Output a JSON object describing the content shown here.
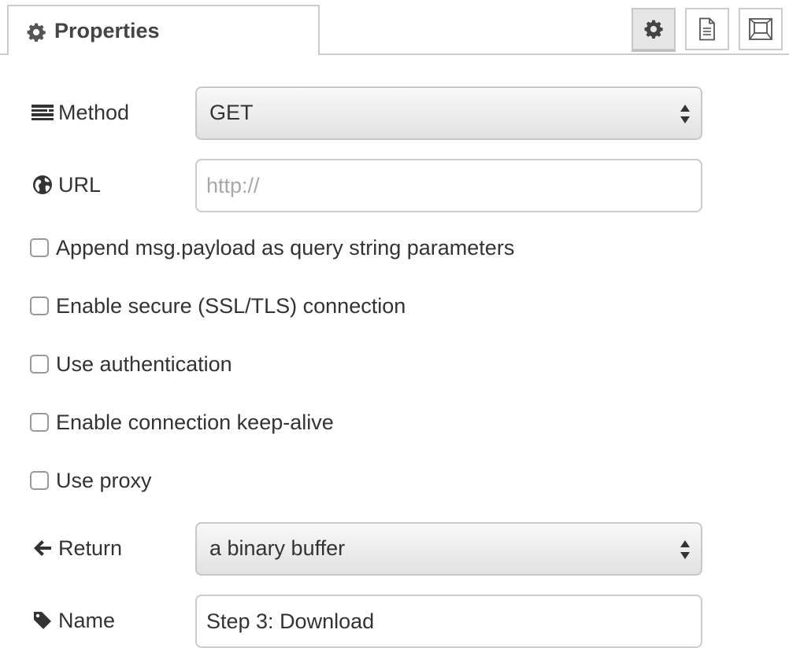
{
  "tabs": {
    "properties_label": "Properties",
    "icons": [
      "gear-icon",
      "document-icon",
      "frame-icon"
    ]
  },
  "form": {
    "method": {
      "label": "Method",
      "icon": "list-icon",
      "value": "GET"
    },
    "url": {
      "label": "URL",
      "icon": "globe-icon",
      "value": "",
      "placeholder": "http://"
    },
    "checkboxes": [
      {
        "label": "Append msg.payload as query string parameters",
        "checked": false
      },
      {
        "label": "Enable secure (SSL/TLS) connection",
        "checked": false
      },
      {
        "label": "Use authentication",
        "checked": false
      },
      {
        "label": "Enable connection keep-alive",
        "checked": false
      },
      {
        "label": "Use proxy",
        "checked": false
      }
    ],
    "return": {
      "label": "Return",
      "icon": "arrow-left-icon",
      "value": "a binary buffer"
    },
    "name": {
      "label": "Name",
      "icon": "tag-icon",
      "value": "Step 3: Download"
    }
  },
  "colors": {
    "border": "#cccccc",
    "text": "#333333",
    "placeholder": "#a8a8a8",
    "active_tool": "#e6e6e6"
  }
}
